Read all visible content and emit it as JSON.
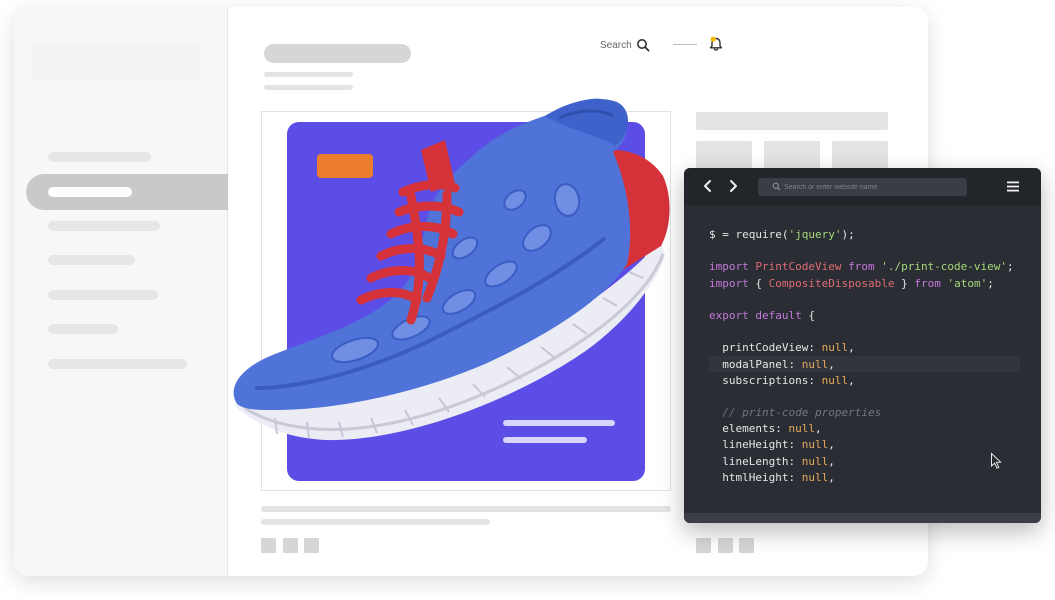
{
  "header": {
    "search_label": "Search",
    "search_icon": "search-icon",
    "bell_icon": "bell-icon",
    "bell_dot_color": "#f5b700"
  },
  "product": {
    "card_color": "#5b4de6",
    "badge_color": "#ec7d2c",
    "image": "running-shoe-blue-red"
  },
  "code_window": {
    "back_icon": "chevron-left-icon",
    "forward_icon": "chevron-right-icon",
    "address_placeholder": "Search or enter website name",
    "menu_icon": "hamburger-menu-icon",
    "pointer_icon": "mouse-pointer-icon",
    "lines": [
      [
        {
          "t": "$ = require(",
          "c": "prop"
        },
        {
          "t": "'jquery'",
          "c": "str"
        },
        {
          "t": ");",
          "c": "prop"
        }
      ],
      [],
      [
        {
          "t": "import ",
          "c": "kw"
        },
        {
          "t": "PrintCodeView",
          "c": "cls"
        },
        {
          "t": " from ",
          "c": "kw"
        },
        {
          "t": "'./print-code-view'",
          "c": "str"
        },
        {
          "t": ";",
          "c": "prop"
        }
      ],
      [
        {
          "t": "import ",
          "c": "kw"
        },
        {
          "t": "{ ",
          "c": "prop"
        },
        {
          "t": "CompositeDisposable",
          "c": "cls"
        },
        {
          "t": " } ",
          "c": "prop"
        },
        {
          "t": "from ",
          "c": "kw"
        },
        {
          "t": "'atom'",
          "c": "str"
        },
        {
          "t": ";",
          "c": "prop"
        }
      ],
      [],
      [
        {
          "t": "export default ",
          "c": "kw"
        },
        {
          "t": "{",
          "c": "prop"
        }
      ],
      [],
      [
        {
          "t": "  printCodeView: ",
          "c": "prop"
        },
        {
          "t": "null",
          "c": "null"
        },
        {
          "t": ",",
          "c": "prop"
        }
      ],
      [
        {
          "t": "  modalPanel: ",
          "c": "prop"
        },
        {
          "t": "null",
          "c": "null"
        },
        {
          "t": ",",
          "c": "prop"
        }
      ],
      [
        {
          "t": "  subscriptions: ",
          "c": "prop"
        },
        {
          "t": "null",
          "c": "null"
        },
        {
          "t": ",",
          "c": "prop"
        }
      ],
      [],
      [
        {
          "t": "  // print-code properties",
          "c": "cmt"
        }
      ],
      [
        {
          "t": "  elements: ",
          "c": "prop"
        },
        {
          "t": "null",
          "c": "null"
        },
        {
          "t": ",",
          "c": "prop"
        }
      ],
      [
        {
          "t": "  lineHeight: ",
          "c": "prop"
        },
        {
          "t": "null",
          "c": "null"
        },
        {
          "t": ",",
          "c": "prop"
        }
      ],
      [
        {
          "t": "  lineLength: ",
          "c": "prop"
        },
        {
          "t": "null",
          "c": "null"
        },
        {
          "t": ",",
          "c": "prop"
        }
      ],
      [
        {
          "t": "  htmlHeight: ",
          "c": "prop"
        },
        {
          "t": "null",
          "c": "null"
        },
        {
          "t": ",",
          "c": "prop"
        }
      ]
    ]
  }
}
